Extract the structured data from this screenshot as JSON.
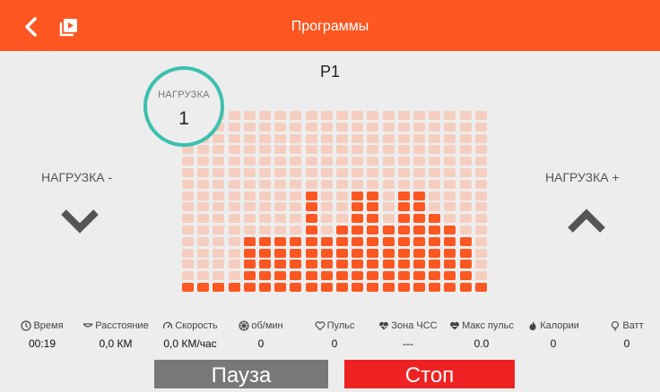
{
  "header": {
    "title": "Программы",
    "back_icon": "chevron-left-icon",
    "media_icon": "video-library-icon",
    "color": "#ff5722"
  },
  "program": {
    "name": "P1"
  },
  "load": {
    "label": "НАГРУЗКА",
    "value": "1",
    "minus_label": "НАГРУЗКА -",
    "plus_label": "НАГРУЗКА +",
    "ring_color": "#3cbfae"
  },
  "profile": {
    "columns": 20,
    "rows": 16,
    "active_color": "#ff5722",
    "inactive_color": "#f5cec0",
    "levels": [
      1,
      1,
      1,
      1,
      5,
      5,
      5,
      5,
      9,
      5,
      6,
      9,
      9,
      6,
      9,
      9,
      7,
      6,
      5,
      1
    ],
    "current_column": 0
  },
  "stats": [
    {
      "icon": "clock-icon",
      "label": "Время",
      "value": "00:19"
    },
    {
      "icon": "distance-icon",
      "label": "Расстояние",
      "value": "0,0 КМ"
    },
    {
      "icon": "speed-icon",
      "label": "Скорость",
      "value": "0,0 КМ/час"
    },
    {
      "icon": "rpm-icon",
      "label": "об/мин",
      "value": "0"
    },
    {
      "icon": "heart-outline-icon",
      "label": "Пульс",
      "value": "0"
    },
    {
      "icon": "heart-zone-icon",
      "label": "Зона ЧСС",
      "value": "---"
    },
    {
      "icon": "heart-max-icon",
      "label": "Макс пульс",
      "value": "0.0"
    },
    {
      "icon": "flame-icon",
      "label": "Калории",
      "value": "0"
    },
    {
      "icon": "bulb-icon",
      "label": "Ватт",
      "value": "0"
    }
  ],
  "actions": {
    "pause_label": "Пауза",
    "stop_label": "Стоп",
    "pause_color": "#787878",
    "stop_color": "#ee2222"
  }
}
